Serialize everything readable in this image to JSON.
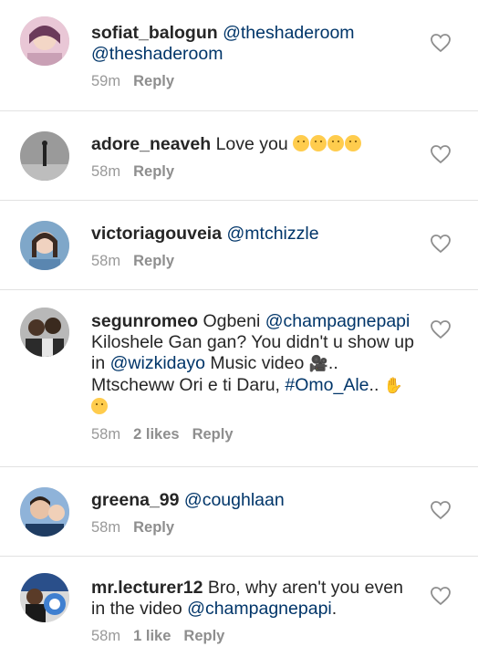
{
  "comments": [
    {
      "username": "sofiat_balogun",
      "text_parts": [
        "@theshaderoom",
        "@theshaderoom"
      ],
      "time": "59m",
      "likes": "",
      "reply": "Reply"
    },
    {
      "username": "adore_neaveh",
      "text": "Love you",
      "time": "58m",
      "likes": "",
      "reply": "Reply"
    },
    {
      "username": "victoriagouveia",
      "mention": "@mtchizzle",
      "time": "58m",
      "likes": "",
      "reply": "Reply"
    },
    {
      "username": "segunromeo",
      "text_1": "Ogbeni",
      "mention_1": "@champagnepapi",
      "text_2": "Kiloshele Gan gan? You didn't u show up in",
      "mention_2": "@wizkidayo",
      "text_3": "Music video",
      "text_4": "..",
      "text_5": "Mtscheww Ori e ti Daru,",
      "hashtag": "#Omo_Ale",
      "text_6": "..",
      "time": "58m",
      "likes": "2 likes",
      "reply": "Reply"
    },
    {
      "username": "greena_99",
      "mention": "@coughlaan",
      "time": "58m",
      "likes": "",
      "reply": "Reply"
    },
    {
      "username": "mr.lecturer12",
      "text_1": "Bro,  why aren't you even in the video",
      "mention": "@champagnepapi",
      "text_2": ".",
      "time": "58m",
      "likes": "1 like",
      "reply": "Reply"
    }
  ],
  "icons": {
    "heart": "heart-outline-icon",
    "video_camera": "video-camera-icon",
    "raised_hand": "raised-hand-icon"
  },
  "colors": {
    "mention": "#003569",
    "meta": "#999999",
    "divider": "#e2e2e2"
  }
}
